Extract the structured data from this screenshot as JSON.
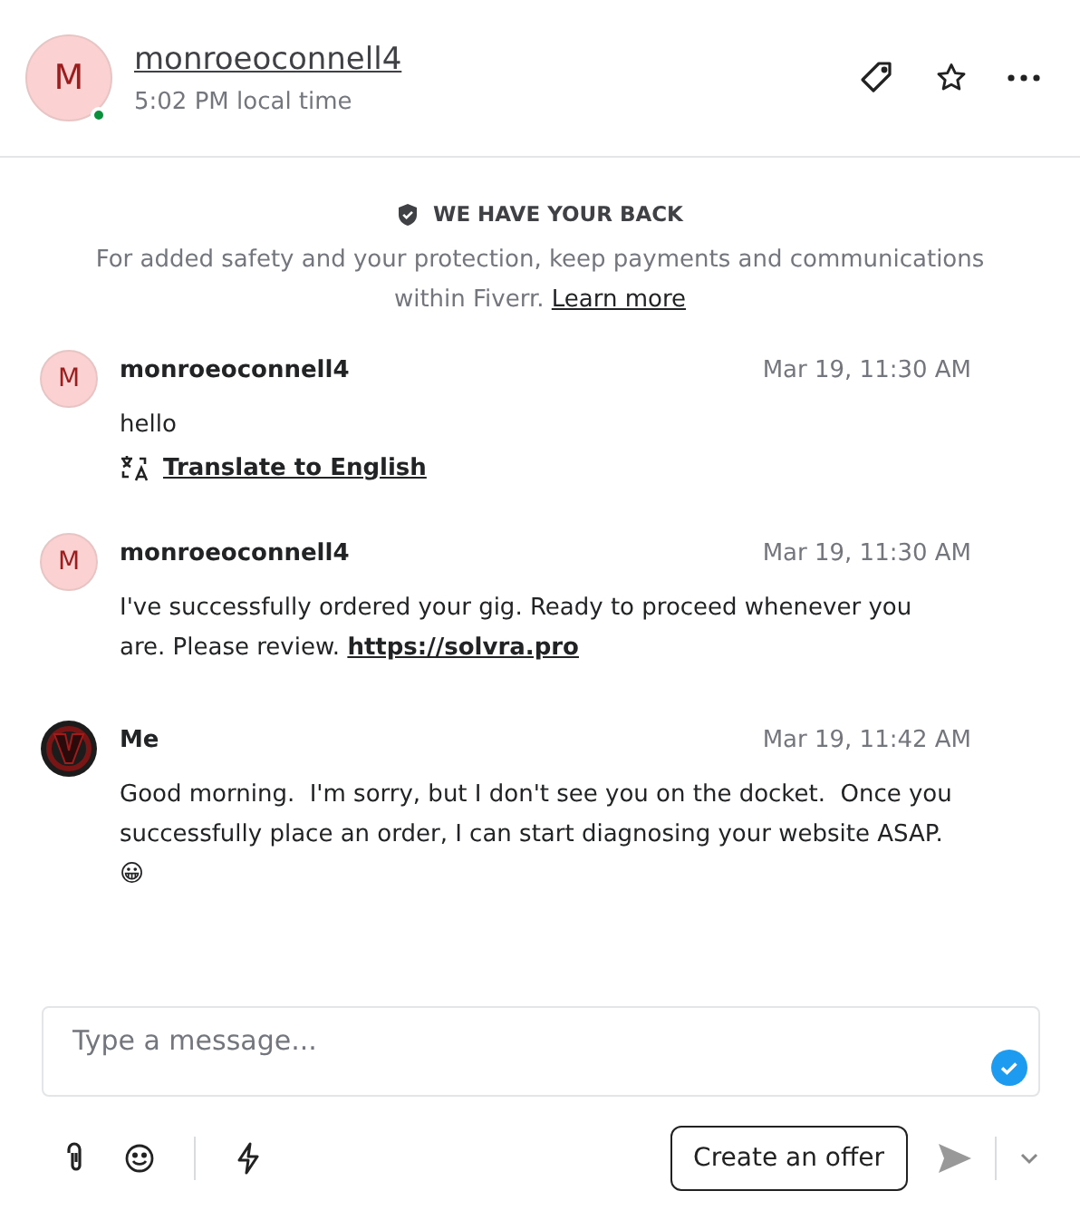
{
  "header": {
    "avatar_letter": "M",
    "online": true,
    "username": "monroeoconnell4",
    "local_time": "5:02 PM local time"
  },
  "notice": {
    "title": "WE HAVE YOUR BACK",
    "text": "For added safety and your protection, keep payments and communications within Fiverr.",
    "link": "Learn more"
  },
  "messages": [
    {
      "avatar": {
        "kind": "letter",
        "letter": "M"
      },
      "sender": "monroeoconnell4",
      "time": "Mar 19, 11:30 AM",
      "text": "hello",
      "translate": "Translate to English"
    },
    {
      "avatar": {
        "kind": "letter",
        "letter": "M"
      },
      "sender": "monroeoconnell4",
      "time": "Mar 19, 11:30 AM",
      "text": "I've successfully ordered your gig. Ready to proceed whenever you are. Please review.",
      "link": "https://solvra.pro"
    },
    {
      "avatar": {
        "kind": "logo"
      },
      "sender": "Me",
      "time": "Mar 19, 11:42 AM",
      "text": "Good morning.  I'm sorry, but I don't see you on the docket.  Once you successfully place an order, I can start diagnosing your website ASAP. 😀"
    }
  ],
  "composer": {
    "placeholder": "Type a message...",
    "offer_button": "Create an offer"
  }
}
